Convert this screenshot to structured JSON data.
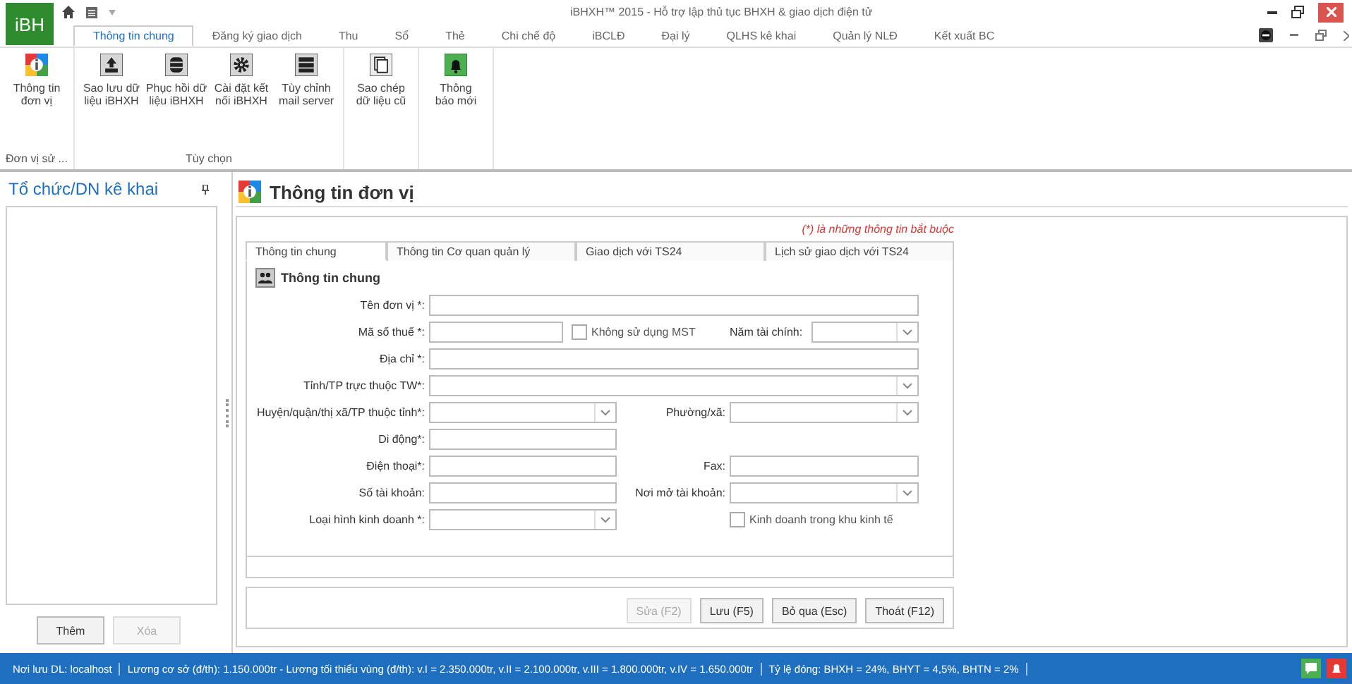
{
  "app": {
    "logo": "iBH",
    "title": "iBHXH™ 2015 - Hỗ trợ lập thủ tục BHXH & giao dịch điện tử"
  },
  "ribbon_tabs": [
    {
      "label": "Thông tin chung",
      "selected": true
    },
    {
      "label": "Đăng ký giao dịch",
      "selected": false
    },
    {
      "label": "Thu",
      "selected": false
    },
    {
      "label": "Sổ",
      "selected": false
    },
    {
      "label": "Thẻ",
      "selected": false
    },
    {
      "label": "Chi chế độ",
      "selected": false
    },
    {
      "label": "iBCLĐ",
      "selected": false
    },
    {
      "label": "Đại lý",
      "selected": false
    },
    {
      "label": "QLHS kê khai",
      "selected": false
    },
    {
      "label": "Quản lý NLĐ",
      "selected": false
    },
    {
      "label": "Kết xuất BC",
      "selected": false
    }
  ],
  "ribbon_groups": [
    {
      "label": "Đơn vị sử ...",
      "buttons": [
        {
          "kind": "info",
          "label": "Thông tin\nđơn vị"
        }
      ]
    },
    {
      "label": "Tùy chọn",
      "buttons": [
        {
          "kind": "upload",
          "label": "Sao lưu dữ\nliệu iBHXH"
        },
        {
          "kind": "database",
          "label": "Phục hồi dữ\nliệu iBHXH"
        },
        {
          "kind": "gear",
          "label": "Cài đặt kết\nnối iBHXH"
        },
        {
          "kind": "server",
          "label": "Tùy chỉnh\nmail server"
        }
      ]
    },
    {
      "buttons": [
        {
          "kind": "copy",
          "label": "Sao chép\ndữ liệu cũ"
        }
      ]
    },
    {
      "buttons": [
        {
          "kind": "bell",
          "label": "Thông\nbáo mới"
        }
      ]
    }
  ],
  "sidebar": {
    "title": "Tổ chức/DN kê khai",
    "buttons": [
      {
        "label": "Thêm",
        "disabled": false
      },
      {
        "label": "Xóa",
        "disabled": true
      }
    ]
  },
  "panel": {
    "title": "Thông tin đơn vị",
    "required_note": "(*) là những thông tin bắt buộc",
    "tabs": [
      {
        "label": "Thông tin chung",
        "selected": true
      },
      {
        "label": "Thông tin Cơ quan quản lý",
        "selected": false
      },
      {
        "label": "Giao dịch với TS24",
        "selected": false
      },
      {
        "label": "Lịch sử giao dịch với TS24",
        "selected": false
      }
    ],
    "section": "Thông tin chung",
    "rows": [
      {
        "label": "Tên đơn vị *:",
        "field": {
          "kind": "text",
          "full": true
        }
      },
      {
        "label": "Mã số thuế *:",
        "field": {
          "kind": "text"
        },
        "check": {
          "label": "Không sử dụng MST",
          "checked": false
        },
        "right": {
          "label": "Năm tài chính:",
          "field": {
            "kind": "combo"
          }
        }
      },
      {
        "label": "Địa chỉ *:",
        "field": {
          "kind": "text",
          "full": true
        }
      },
      {
        "label": "Tỉnh/TP trực thuộc TW*:",
        "field": {
          "kind": "combo",
          "full": true
        }
      },
      {
        "label": "Huyện/quận/thị xã/TP thuộc tỉnh*:",
        "field": {
          "kind": "combo"
        },
        "right": {
          "label": "Phường/xã:",
          "field": {
            "kind": "combo"
          }
        }
      },
      {
        "label": "Di động*:",
        "field": {
          "kind": "text"
        }
      },
      {
        "label": "Điện thoại*:",
        "field": {
          "kind": "text"
        },
        "right": {
          "label": "Fax:",
          "field": {
            "kind": "text"
          }
        }
      },
      {
        "label": "Số tài khoản:",
        "field": {
          "kind": "text"
        },
        "right": {
          "label": "Nơi mở tài khoản:",
          "field": {
            "kind": "combo"
          }
        }
      },
      {
        "label": "Loại hình kinh doanh *:",
        "field": {
          "kind": "combo"
        },
        "right": {
          "check": {
            "label": "Kinh doanh trong khu kinh tế",
            "checked": false
          }
        }
      }
    ],
    "buttons": [
      {
        "label": "Sửa (F2)",
        "disabled": true
      },
      {
        "label": "Lưu (F5)",
        "disabled": false
      },
      {
        "label": "Bỏ qua (Esc)",
        "disabled": false
      },
      {
        "label": "Thoát (F12)",
        "disabled": false
      }
    ]
  },
  "status_bar": {
    "segments": [
      "Nơi lưu DL: localhost",
      "Lương cơ sở (đ/th): 1.150.000tr - Lương tối thiểu vùng (đ/th): v.I = 2.350.000tr, v.II = 2.100.000tr, v.III = 1.800.000tr, v.IV = 1.650.000tr",
      "Tỷ lệ đóng: BHXH = 24%, BHYT = 4,5%, BHTN = 2%"
    ]
  }
}
